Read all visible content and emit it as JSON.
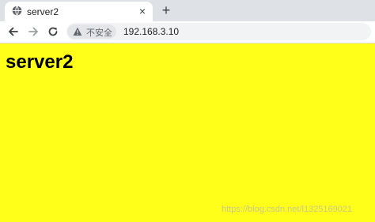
{
  "tab": {
    "title": "server2",
    "favicon": "globe-icon",
    "close_icon": "×",
    "new_tab_icon": "+"
  },
  "toolbar": {
    "back_icon": "arrow-left-icon",
    "forward_icon": "arrow-right-icon",
    "reload_icon": "reload-icon",
    "security_icon": "warning-icon",
    "security_label": "不安全",
    "url": "192.168.3.10"
  },
  "page": {
    "heading": "server2",
    "background_color": "#ffff1a"
  },
  "watermark": {
    "text": "https://blog.csdn.net/l1325169021"
  }
}
